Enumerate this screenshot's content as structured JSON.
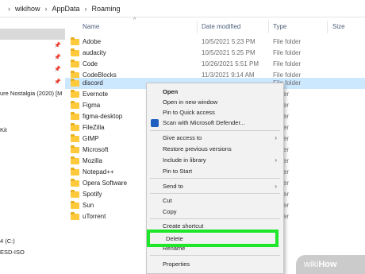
{
  "breadcrumb": [
    "wikihow",
    "AppData",
    "Roaming"
  ],
  "columns": {
    "name": "Name",
    "date": "Date modified",
    "type": "Type",
    "size": "Size"
  },
  "nav": [
    {
      "label": ""
    },
    {
      "label": ""
    },
    {
      "label": ""
    },
    {
      "label": "ure Nostalgia (2020) [M"
    },
    {
      "label": ""
    },
    {
      "label": "Kit"
    },
    {
      "label": "4 (C:)"
    },
    {
      "label": "ESD-ISO"
    }
  ],
  "files": [
    {
      "name": "Adobe",
      "date": "10/5/2021 5:23 PM",
      "type": "File folder"
    },
    {
      "name": "audacity",
      "date": "10/5/2021 5:25 PM",
      "type": "File folder"
    },
    {
      "name": "Code",
      "date": "10/26/2021 5:51 PM",
      "type": "File folder"
    },
    {
      "name": "CodeBlocks",
      "date": "11/3/2021 9:14 AM",
      "type": "File folder"
    },
    {
      "name": "discord",
      "date": "",
      "type": "File folder"
    },
    {
      "name": "Evernote",
      "date": "",
      "type": "folder"
    },
    {
      "name": "Figma",
      "date": "",
      "type": "folder"
    },
    {
      "name": "figma-desktop",
      "date": "",
      "type": "folder"
    },
    {
      "name": "FileZilla",
      "date": "",
      "type": "folder"
    },
    {
      "name": "GIMP",
      "date": "",
      "type": "folder"
    },
    {
      "name": "Microsoft",
      "date": "",
      "type": "folder"
    },
    {
      "name": "Mozilla",
      "date": "",
      "type": "folder"
    },
    {
      "name": "Notepad++",
      "date": "",
      "type": "folder"
    },
    {
      "name": "Opera Software",
      "date": "",
      "type": "folder"
    },
    {
      "name": "Spotify",
      "date": "",
      "type": "folder"
    },
    {
      "name": "Sun",
      "date": "",
      "type": "folder"
    },
    {
      "name": "uTorrent",
      "date": "",
      "type": "folder"
    }
  ],
  "context_menu": {
    "open": "Open",
    "open_new_window": "Open in new window",
    "pin_quick_access": "Pin to Quick access",
    "scan_defender": "Scan with Microsoft Defender...",
    "give_access": "Give access to",
    "restore_versions": "Restore previous versions",
    "include_library": "Include in library",
    "pin_start": "Pin to Start",
    "send_to": "Send to",
    "cut": "Cut",
    "copy": "Copy",
    "create_shortcut": "Create shortcut",
    "delete": "Delete",
    "rename": "Rename",
    "properties": "Properties"
  },
  "highlight_color": "#1ee62a",
  "logo": {
    "prefix": "wiki",
    "suffix": "How"
  }
}
